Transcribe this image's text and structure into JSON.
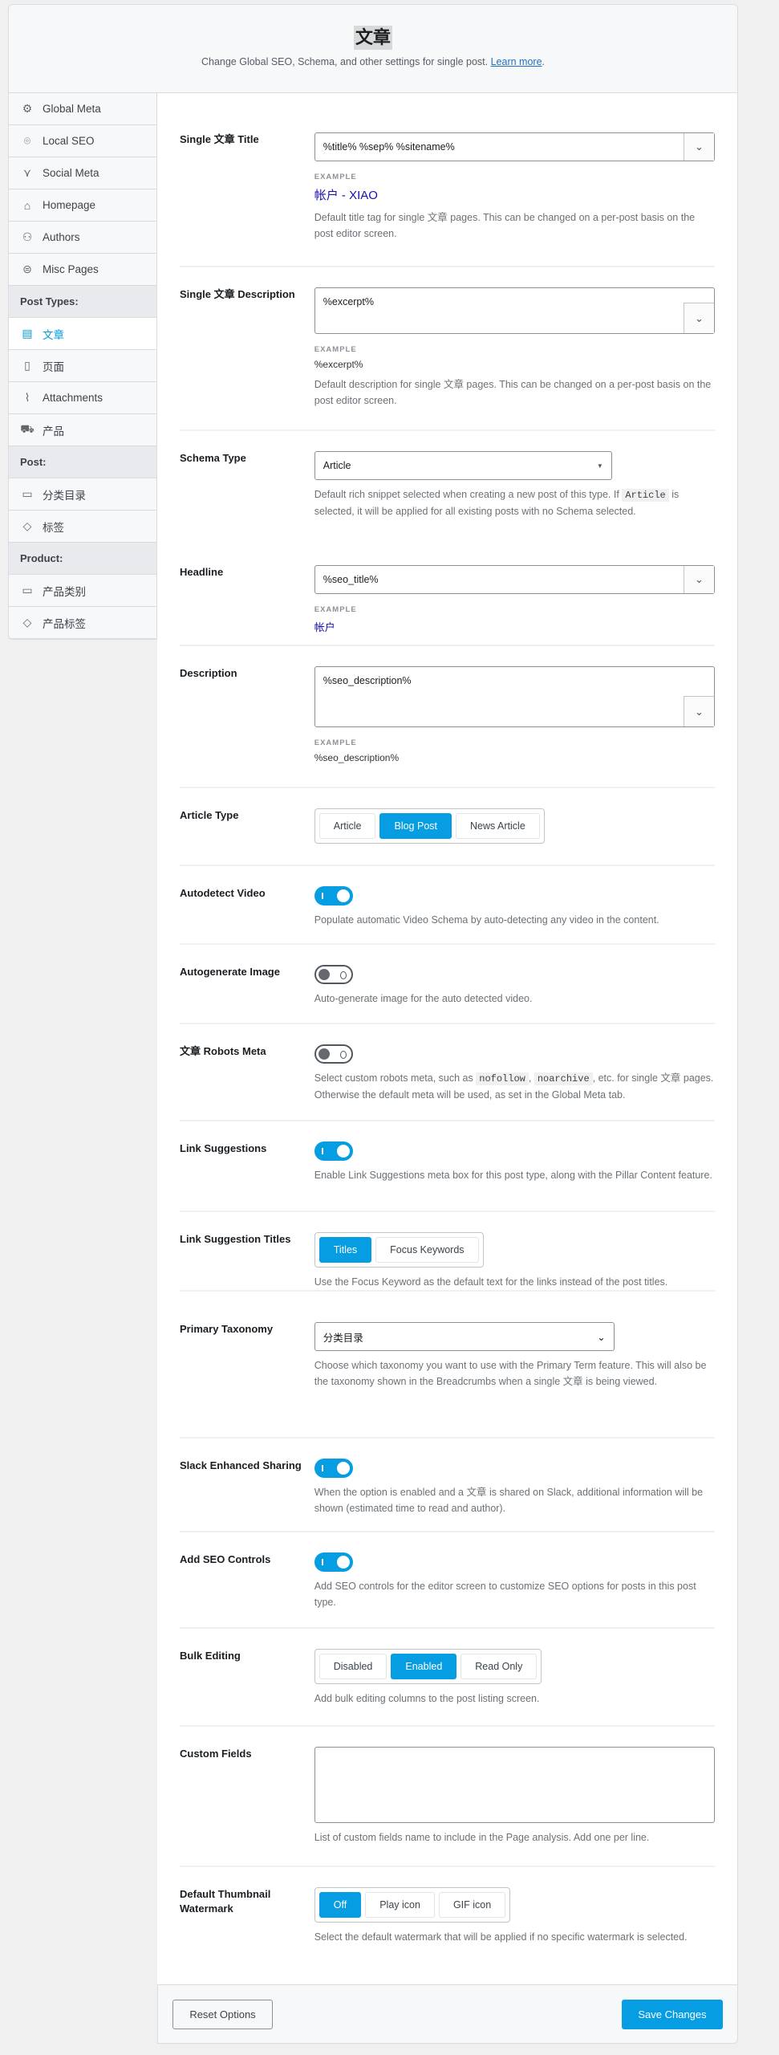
{
  "header": {
    "title": "文章",
    "subtitle": "Change Global SEO, Schema, and other settings for single post.",
    "learn_more": "Learn more",
    "period": "."
  },
  "sidebar": {
    "items": [
      {
        "label": "Global Meta",
        "icon": "gear-icon",
        "glyph": "⚙"
      },
      {
        "label": "Local SEO",
        "icon": "location-pin-icon",
        "glyph": "⌾"
      },
      {
        "label": "Social Meta",
        "icon": "share-icon",
        "glyph": "⋎"
      },
      {
        "label": "Homepage",
        "icon": "home-icon",
        "glyph": "⌂"
      },
      {
        "label": "Authors",
        "icon": "users-icon",
        "glyph": "⚇"
      },
      {
        "label": "Misc Pages",
        "icon": "misc-pages-icon",
        "glyph": "⊜"
      }
    ],
    "post_types_header": "Post Types:",
    "post_types": [
      {
        "label": "文章",
        "icon": "post-icon",
        "glyph": "▤",
        "active": true
      },
      {
        "label": "页面",
        "icon": "page-icon",
        "glyph": "▯"
      },
      {
        "label": "Attachments",
        "icon": "paperclip-icon",
        "glyph": "⌇"
      },
      {
        "label": "产品",
        "icon": "cart-icon",
        "glyph": "⛟"
      }
    ],
    "post_header": "Post:",
    "post": [
      {
        "label": "分类目录",
        "icon": "folder-icon",
        "glyph": "▭"
      },
      {
        "label": "标签",
        "icon": "tag-icon",
        "glyph": "◇"
      }
    ],
    "product_header": "Product:",
    "product": [
      {
        "label": "产品类别",
        "icon": "folder-icon",
        "glyph": "▭"
      },
      {
        "label": "产品标签",
        "icon": "tag-icon",
        "glyph": "◇"
      }
    ]
  },
  "fields": {
    "title": {
      "label": "Single 文章 Title",
      "value": "%title% %sep% %sitename%",
      "example_label": "EXAMPLE",
      "example": "帐户 - XIAO",
      "desc": "Default title tag for single 文章 pages. This can be changed on a per-post basis on the post editor screen."
    },
    "description": {
      "label": "Single 文章 Description",
      "value": "%excerpt%",
      "example_label": "EXAMPLE",
      "example": "%excerpt%",
      "desc": "Default description for single 文章 pages. This can be changed on a per-post basis on the post editor screen."
    },
    "schema": {
      "label": "Schema Type",
      "value": "Article",
      "desc_before": "Default rich snippet selected when creating a new post of this type. If",
      "desc_code": "Article",
      "desc_after": "is selected, it will be applied for all existing posts with no Schema selected."
    },
    "headline": {
      "label": "Headline",
      "value": "%seo_title%",
      "example_label": "EXAMPLE",
      "example": "帐户"
    },
    "schema_description": {
      "label": "Description",
      "value": "%seo_description%",
      "example_label": "EXAMPLE",
      "example": "%seo_description%"
    },
    "article_type": {
      "label": "Article Type",
      "options": [
        "Article",
        "Blog Post",
        "News Article"
      ],
      "selected": "Blog Post"
    },
    "autodetect_video": {
      "label": "Autodetect Video",
      "enabled": true,
      "desc": "Populate automatic Video Schema by auto-detecting any video in the content."
    },
    "autogenerate_image": {
      "label": "Autogenerate Image",
      "enabled": false,
      "desc": "Auto-generate image for the auto detected video."
    },
    "robots_meta": {
      "label": "文章 Robots Meta",
      "enabled": false,
      "desc_1": "Select custom robots meta, such as",
      "code_1": "nofollow",
      "sep": ",",
      "code_2": "noarchive",
      "desc_2": ", etc. for single 文章 pages. Otherwise the default meta will be used, as set in the Global Meta tab."
    },
    "link_suggestions": {
      "label": "Link Suggestions",
      "enabled": true,
      "desc": "Enable Link Suggestions meta box for this post type, along with the Pillar Content feature."
    },
    "link_suggestion_titles": {
      "label": "Link Suggestion Titles",
      "options": [
        "Titles",
        "Focus Keywords"
      ],
      "selected": "Titles",
      "desc": "Use the Focus Keyword as the default text for the links instead of the post titles."
    },
    "primary_taxonomy": {
      "label": "Primary Taxonomy",
      "value": "分类目录",
      "desc": "Choose which taxonomy you want to use with the Primary Term feature. This will also be the taxonomy shown in the Breadcrumbs when a single 文章 is being viewed."
    },
    "slack": {
      "label": "Slack Enhanced Sharing",
      "enabled": true,
      "desc": "When the option is enabled and a 文章 is shared on Slack, additional information will be shown (estimated time to read and author)."
    },
    "seo_controls": {
      "label": "Add SEO Controls",
      "enabled": true,
      "desc": "Add SEO controls for the editor screen to customize SEO options for posts in this post type."
    },
    "bulk_editing": {
      "label": "Bulk Editing",
      "options": [
        "Disabled",
        "Enabled",
        "Read Only"
      ],
      "selected": "Enabled",
      "desc": "Add bulk editing columns to the post listing screen."
    },
    "custom_fields": {
      "label": "Custom Fields",
      "value": "",
      "desc": "List of custom fields name to include in the Page analysis. Add one per line."
    },
    "thumbnail_watermark": {
      "label": "Default Thumbnail Watermark",
      "options": [
        "Off",
        "Play icon",
        "GIF icon"
      ],
      "selected": "Off",
      "desc": "Select the default watermark that will be applied if no specific watermark is selected."
    }
  },
  "footer": {
    "reset": "Reset Options",
    "save": "Save Changes"
  },
  "colors": {
    "accent": "#069de3",
    "example_link": "#1a0dab"
  }
}
